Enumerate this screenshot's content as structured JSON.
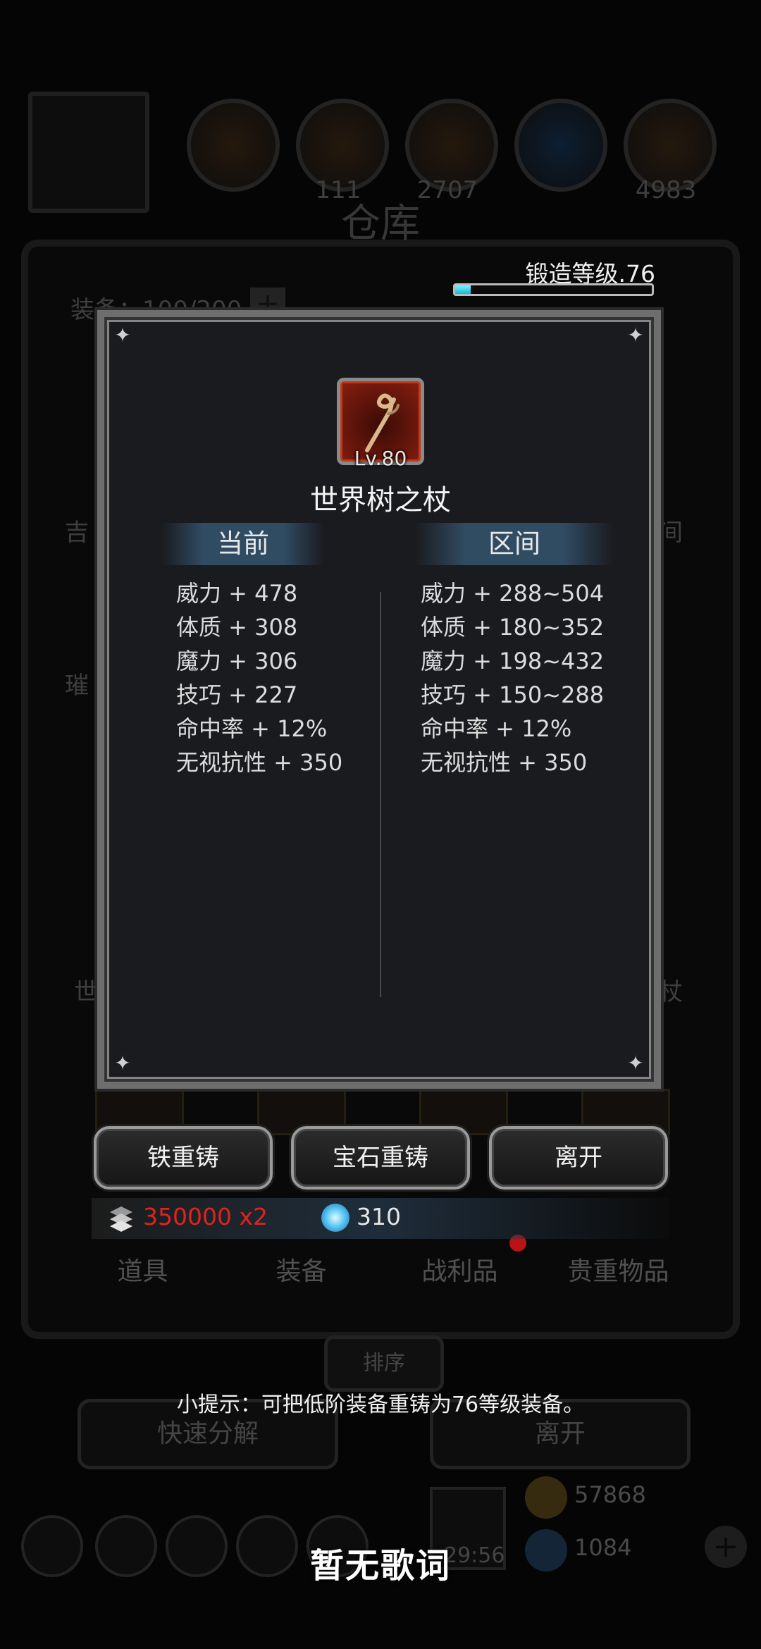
{
  "background": {
    "resources": [
      "",
      "111",
      "2707",
      "",
      "4983"
    ],
    "title": "仓库",
    "capacity": "装备：100/200",
    "side_labels_left": [
      "吉",
      "璀",
      "",
      "世"
    ],
    "side_labels_right": [
      "间",
      "",
      "",
      "杖"
    ],
    "tabs": [
      "道具",
      "装备",
      "战利品",
      "贵重物品"
    ],
    "sort_label": "排序",
    "quick_decompose_label": "快速分解",
    "leave_label": "离开",
    "timer": "29:56",
    "gold": "57868",
    "gems": "1084"
  },
  "forge": {
    "label": "锻造等级.76",
    "progress": 0.08
  },
  "item": {
    "level": "Lv.80",
    "name": "世界树之杖"
  },
  "stats": {
    "current_header": "当前",
    "range_header": "区间",
    "current": [
      "威力 + 478",
      "体质 + 308",
      "魔力 + 306",
      "技巧 + 227",
      "命中率 + 12%",
      "无视抗性 + 350"
    ],
    "range": [
      "威力 + 288~504",
      "体质 + 180~352",
      "魔力 + 198~432",
      "技巧 + 150~288",
      "命中率 + 12%",
      "无视抗性 + 350"
    ]
  },
  "actions": {
    "iron_reforge": "铁重铸",
    "gem_reforge": "宝石重铸",
    "leave": "离开"
  },
  "cost": {
    "iron": "350000 x2",
    "gem": "310"
  },
  "tip": "小提示：可把低阶装备重铸为76等级装备。",
  "lyrics": "暂无歌词",
  "colors": {
    "iron_cost": "#e0231f",
    "forge_fill": "#1cb7d2",
    "item_frame": "#c23a1e"
  }
}
